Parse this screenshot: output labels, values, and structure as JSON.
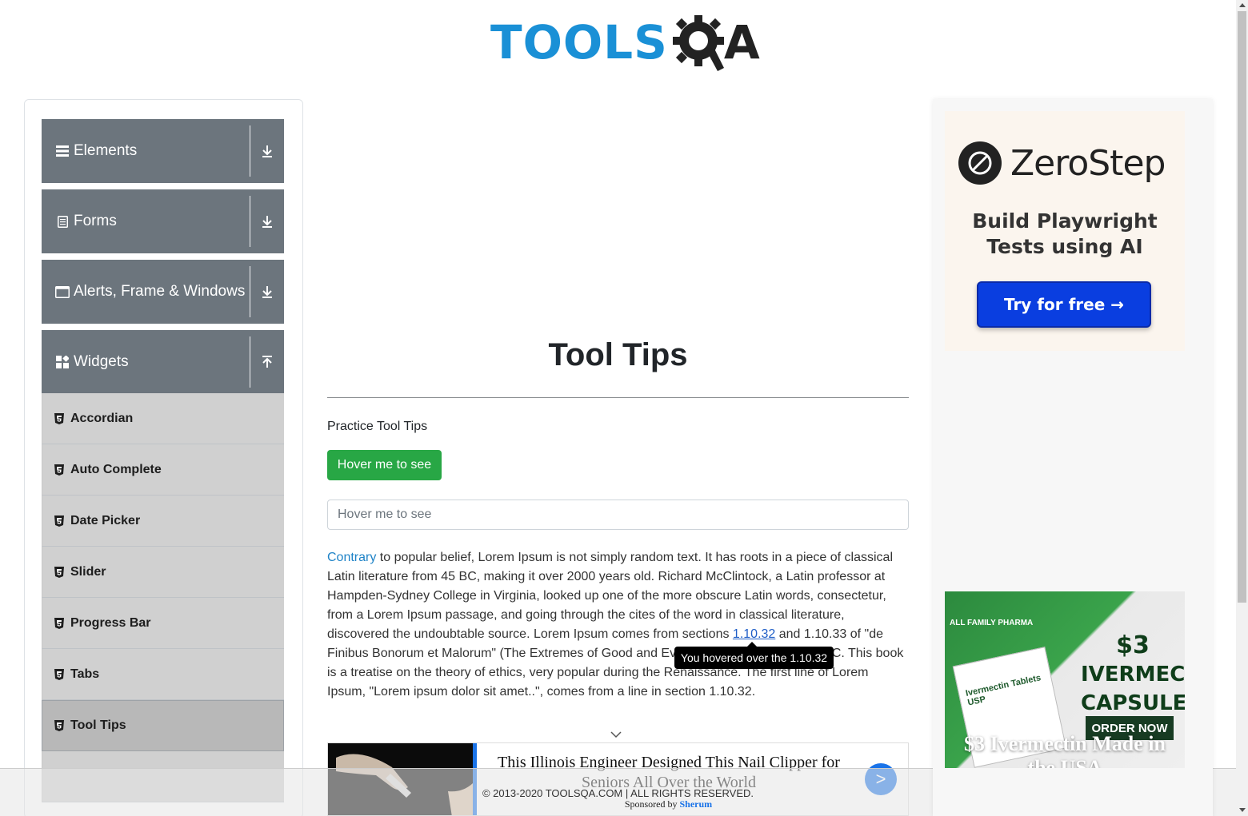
{
  "header": {
    "logo_tools": "TOOLS",
    "logo_a": "A"
  },
  "sidebar": {
    "groups": [
      {
        "label": "Elements",
        "icon": "hamburger-icon",
        "arrow": "download-icon"
      },
      {
        "label": "Forms",
        "icon": "document-icon",
        "arrow": "download-icon"
      },
      {
        "label": "Alerts, Frame & Windows",
        "icon": "window-icon",
        "arrow": "download-icon"
      },
      {
        "label": "Widgets",
        "icon": "widgets-icon",
        "arrow": "upload-icon"
      }
    ],
    "items": [
      {
        "label": "Accordian",
        "icon": "html5-icon"
      },
      {
        "label": "Auto Complete",
        "icon": "html5-icon"
      },
      {
        "label": "Date Picker",
        "icon": "html5-icon"
      },
      {
        "label": "Slider",
        "icon": "html5-icon"
      },
      {
        "label": "Progress Bar",
        "icon": "html5-icon"
      },
      {
        "label": "Tabs",
        "icon": "html5-icon"
      },
      {
        "label": "Tool Tips",
        "icon": "html5-icon",
        "active": true
      }
    ]
  },
  "main": {
    "title": "Tool Tips",
    "subtitle": "Practice Tool Tips",
    "button_label": "Hover me to see",
    "field_placeholder": "Hover me to see",
    "paragraph": {
      "link1": "Contrary",
      "text1": " to popular belief, Lorem Ipsum is not simply random text. It has roots in a piece of classical Latin literature from 45 BC, making it over 2000 years old. Richard McClintock, a Latin professor at Hampden-Sydney College in Virginia, looked up one of the more obscure Latin words, consectetur, from a Lorem Ipsum passage, and going through the cites of the word in classical literature, discovered the undoubtable source. Lorem Ipsum comes from sections ",
      "link2": "1.10.32",
      "text2": " and 1.10.33 of \"de Finibus Bonorum et Malorum\" (The Extremes of Good and Evil) by Cicero, written in 45 BC. This book is a treatise on the theory of ethics, very popular during the Renaissance. The first line of Lorem Ipsum, \"Lorem ipsum dolor sit amet..\", comes from a line in section 1.10.32."
    },
    "tooltip": "You hovered over the 1.10.32"
  },
  "ad_banner": {
    "headline": "This Illinois Engineer Designed This Nail Clipper for Seniors All Over the World",
    "go_label": ">"
  },
  "footer": {
    "copyright": "© 2013-2020 TOOLSQA.COM | ALL RIGHTS RESERVED.",
    "sponsored_prefix": "Sponsored by ",
    "sponsor_name": "Sherum"
  },
  "right_ads": {
    "zerostep": {
      "name": "ZeroStep",
      "tagline_line1": "Build Playwright",
      "tagline_line2": "Tests using AI",
      "cta": "Try for free →"
    },
    "ivermectin": {
      "brand": "ALL FAMILY PHARMA",
      "price_line1": "$3",
      "price_line2": "IVERMECTIN",
      "price_line3": "CAPSULES",
      "box_label": "Ivermectin Tablets USP",
      "order": "ORDER NOW",
      "caption_line1": "$3 Ivermectin Made in",
      "caption_line2": "the USA"
    }
  },
  "colors": {
    "brand_blue": "#1a90d6",
    "sidebar_group": "#6c757d",
    "sidebar_item": "#d0d0d0",
    "success_button": "#28a745"
  }
}
